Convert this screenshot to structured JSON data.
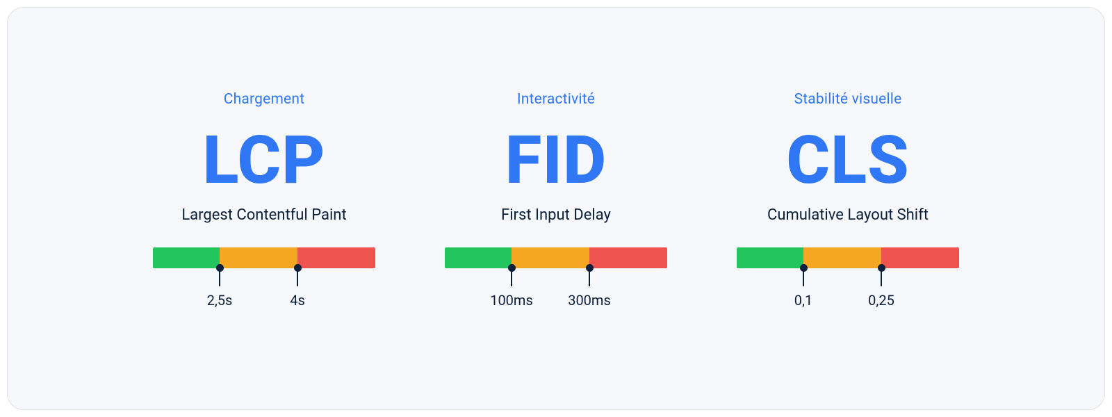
{
  "metrics": [
    {
      "category": "Chargement",
      "abbr": "LCP",
      "fullname": "Largest Contentful Paint",
      "segments": {
        "g": 30,
        "y": 35,
        "r": 35
      },
      "markers": [
        {
          "pos": 30,
          "label": "2,5s"
        },
        {
          "pos": 65,
          "label": "4s"
        }
      ]
    },
    {
      "category": "Interactivité",
      "abbr": "FID",
      "fullname": "First Input Delay",
      "segments": {
        "g": 30,
        "y": 35,
        "r": 35
      },
      "markers": [
        {
          "pos": 30,
          "label": "100ms"
        },
        {
          "pos": 65,
          "label": "300ms"
        }
      ]
    },
    {
      "category": "Stabilité visuelle",
      "abbr": "CLS",
      "fullname": "Cumulative Layout Shift",
      "segments": {
        "g": 30,
        "y": 35,
        "r": 35
      },
      "markers": [
        {
          "pos": 30,
          "label": "0,1"
        },
        {
          "pos": 65,
          "label": "0,25"
        }
      ]
    }
  ]
}
